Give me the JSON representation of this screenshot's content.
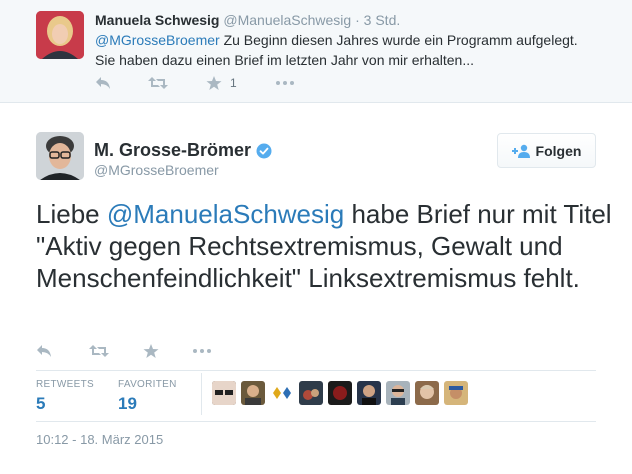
{
  "parent_tweet": {
    "name": "Manuela Schwesig",
    "handle": "@ManuelaSchwesig",
    "separator": "·",
    "time": "3 Std.",
    "mention": "@MGrosseBroemer",
    "text_line1_rest": " Zu Beginn diesen Jahres wurde ein Programm aufgelegt.",
    "text_line2": "Sie haben dazu einen Brief im letzten Jahr von mir erhalten...",
    "favorite_count": "1"
  },
  "main_tweet": {
    "name": "M. Grosse-Brömer",
    "handle": "@MGrosseBroemer",
    "follow_label": "Folgen",
    "text_before": "Liebe ",
    "text_mention": "@ManuelaSchwesig",
    "text_after": " habe Brief nur mit Titel \"Aktiv gegen Rechtsextremismus, Gewalt und Menschenfeindlichkeit\" Linksextremismus fehlt.",
    "stats": {
      "retweets_label": "RETWEETS",
      "retweets_value": "5",
      "favorites_label": "FAVORITEN",
      "favorites_value": "19"
    },
    "timestamp": "10:12 - 18. März 2015"
  },
  "colors": {
    "link": "#2b7bb9",
    "verified": "#55acee",
    "muted": "#8899a6",
    "icon": "#aab8c2"
  },
  "icons": [
    "reply-icon",
    "retweet-icon",
    "star-icon",
    "more-icon",
    "add-user-icon",
    "verified-badge-icon"
  ]
}
